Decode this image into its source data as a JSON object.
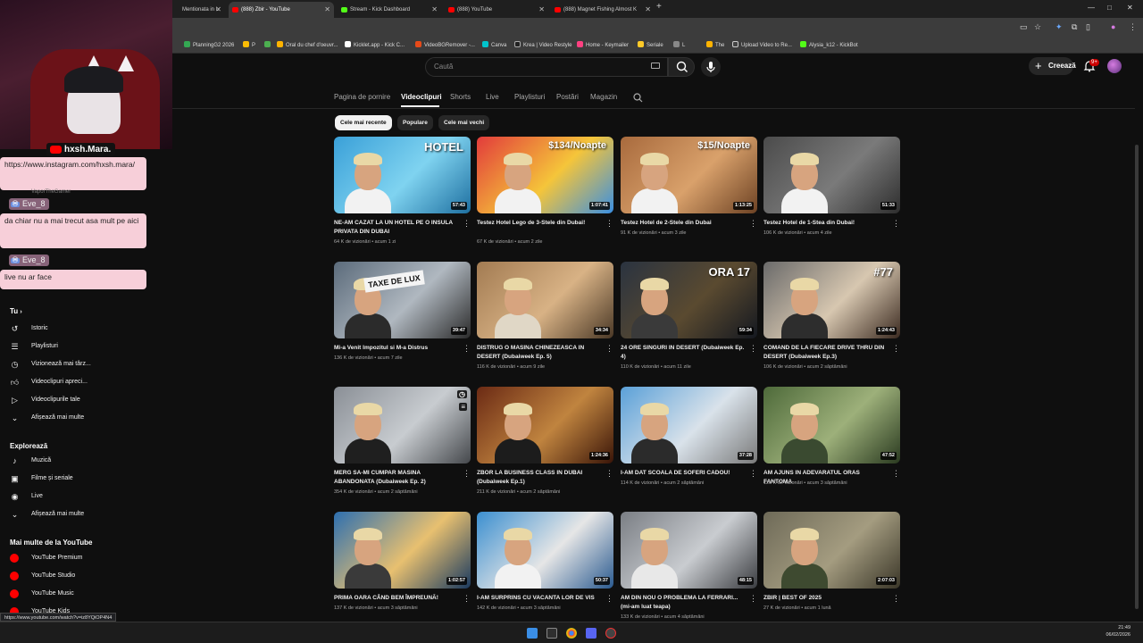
{
  "browser": {
    "tabs": [
      {
        "title": "Mentionata in L"
      },
      {
        "title": "(888) Zbir - YouTube"
      },
      {
        "title": "Stream - Kick Dashboard"
      },
      {
        "title": "(888) YouTube"
      },
      {
        "title": "(888) Magnet Fishing Almost K"
      }
    ],
    "bookmarks": [
      "PlanningG2 2026",
      "P",
      "Oral du chef d'oeuvr...",
      "Kicklet.app - Kick C...",
      "VideoBGRemover -...",
      "Canva",
      "Krea | Video Restyle",
      "Home - Keymailer",
      "Seriale",
      "L",
      "The",
      "Upload Video to Re...",
      "Alysia_k12 - KickBot"
    ],
    "status_url": "https://www.youtube.com/watch?v=iz8YQiOP4N4"
  },
  "header": {
    "search_placeholder": "Caută",
    "create_label": "Creează",
    "notif_count": "9+"
  },
  "channel_tabs": [
    "Pagina de pornire",
    "Videoclipuri",
    "Shorts",
    "Live",
    "Playlisturi",
    "Postări",
    "Magazin"
  ],
  "chips": [
    "Cele mai recente",
    "Populare",
    "Cele mai vechi"
  ],
  "videos": [
    {
      "title": "NE-AM CAZAT LA UN HOTEL PE O INSULA PRIVATA DIN DUBAI",
      "views": "64 K de vizionări",
      "age": "acum 1 zi",
      "duration": "57:43",
      "overlay": "HOTEL"
    },
    {
      "title": "Testez Hotel Lego de 3-Stele din Dubai!",
      "views": "67 K de vizionări",
      "age": "acum 2 zile",
      "duration": "1:07:41",
      "overlay": "$134/Noapte"
    },
    {
      "title": "Testez Hotel de 2-Stele din Dubai",
      "views": "91 K de vizionări",
      "age": "acum 3 zile",
      "duration": "1:13:25",
      "overlay": "$15/Noapte"
    },
    {
      "title": "Testez Hotel de 1-Stea din Dubai!",
      "views": "106 K de vizionări",
      "age": "acum 4 zile",
      "duration": "51:33",
      "overlay": ""
    },
    {
      "title": "Mi-a Venit Impozitul si M-a Distrus",
      "views": "136 K de vizionări",
      "age": "acum 7 zile",
      "duration": "39:47",
      "overlay": "TAXE DE LUX"
    },
    {
      "title": "DISTRUG O MASINA CHINEZEASCA IN DESERT (Dubaiweek Ep. 5)",
      "views": "116 K de vizionări",
      "age": "acum 9 zile",
      "duration": "34:34",
      "overlay": ""
    },
    {
      "title": "24 ORE SINGURI IN DESERT (Dubaiweek Ep. 4)",
      "views": "110 K de vizionări",
      "age": "acum 11 zile",
      "duration": "59:34",
      "overlay": "ORA 17"
    },
    {
      "title": "COMAND DE LA FIECARE DRIVE THRU DIN DESERT (Dubaiweek Ep.3)",
      "views": "106 K de vizionări",
      "age": "acum 2 săptămâni",
      "duration": "1:24:43",
      "overlay": "#77"
    },
    {
      "title": "MERG SA-MI CUMPAR MASINA ABANDONATA (Dubaiweek Ep. 2)",
      "views": "354 K de vizionări",
      "age": "acum 2 săptămâni",
      "duration": "",
      "overlay": ""
    },
    {
      "title": "ZBOR LA BUSINESS CLASS IN DUBAI (Dubaiweek Ep.1)",
      "views": "211 K de vizionări",
      "age": "acum 2 săptămâni",
      "duration": "1:24:36",
      "overlay": ""
    },
    {
      "title": "I-AM DAT SCOALA DE SOFERI CADOU!",
      "views": "114 K de vizionări",
      "age": "acum 2 săptămâni",
      "duration": "37:28",
      "overlay": ""
    },
    {
      "title": "AM AJUNS IN ADEVARATUL ORAS FANTOMA",
      "views": "128 K de vizionări",
      "age": "acum 3 săptămâni",
      "duration": "47:52",
      "overlay": ""
    },
    {
      "title": "PRIMA OARA CÂND BEM ÎMPREUNĂ!",
      "views": "137 K de vizionări",
      "age": "acum 3 săptămâni",
      "duration": "1:02:57",
      "overlay": ""
    },
    {
      "title": "I-AM SURPRINS CU VACANTA LOR DE VIS",
      "views": "142 K de vizionări",
      "age": "acum 3 săptămâni",
      "duration": "50:37",
      "overlay": ""
    },
    {
      "title": "AM DIN NOU O PROBLEMA LA FERRARI... (mi-am luat teapa)",
      "views": "133 K de vizionări",
      "age": "acum 4 săptămâni",
      "duration": "48:15",
      "overlay": ""
    },
    {
      "title": "ZBIR | BEST OF 2025",
      "views": "27 K de vizionări",
      "age": "acum 1 lună",
      "duration": "2:07:03",
      "overlay": ""
    }
  ],
  "sidebar": {
    "you_heading": "Tu",
    "you_items": [
      "Istoric",
      "Playlisturi",
      "Vizionează mai târz...",
      "Videoclipuri apreci...",
      "Videoclipurile tale",
      "Afișează mai multe"
    ],
    "explore_heading": "Explorează",
    "explore_items": [
      "Muzică",
      "Filme și seriale",
      "Live",
      "Afișează mai multe"
    ],
    "more_heading": "Mai multe de la YouTube",
    "more_items": [
      "YouTube Premium",
      "YouTube Studio",
      "YouTube Music",
      "YouTube Kids"
    ]
  },
  "stream_overlay": {
    "streamer_name": "hxsh.Mara.",
    "chat": [
      {
        "text": "https://www.instagram.com/hxsh.mara/"
      },
      {
        "user": "Eve_8",
        "text": "da chiar nu a mai trecut asa mult pe aici"
      },
      {
        "user": "Eve_8",
        "text": "live nu ar face"
      }
    ],
    "ghost_user": "VaporTheGamer"
  },
  "taskbar": {
    "time": "21:49",
    "date": "06/02/2026"
  }
}
